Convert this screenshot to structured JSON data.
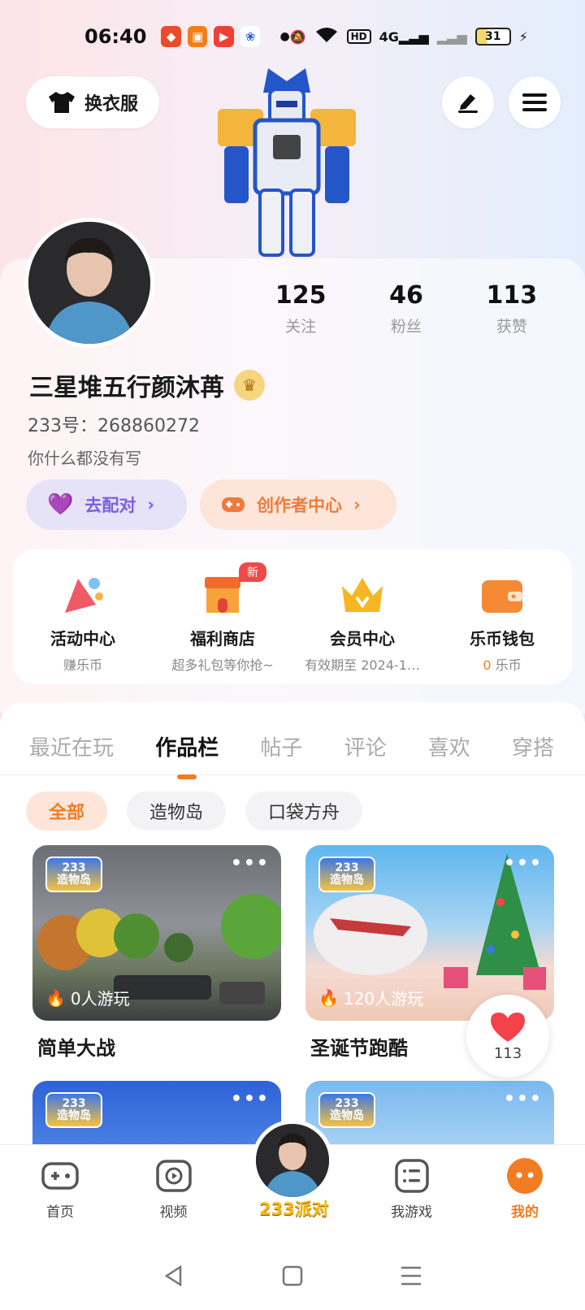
{
  "status_bar": {
    "time": "06:40",
    "network": "4G",
    "battery": "31"
  },
  "header": {
    "change_outfit_label": "换衣服"
  },
  "profile": {
    "stats": [
      {
        "value": "125",
        "label": "关注"
      },
      {
        "value": "46",
        "label": "粉丝"
      },
      {
        "value": "113",
        "label": "获赞"
      }
    ],
    "username": "三星堆五行颜沐苒",
    "uid": "233号：268860272",
    "bio": "你什么都没有写",
    "match_label": "去配对",
    "creator_label": "创作者中心"
  },
  "services": [
    {
      "title": "活动中心",
      "sub": "赚乐币",
      "icon": "party-icon"
    },
    {
      "title": "福利商店",
      "sub": "超多礼包等你抢~",
      "icon": "shop-icon",
      "badge": "新"
    },
    {
      "title": "会员中心",
      "sub": "有效期至 2024-1…",
      "icon": "crown-icon"
    },
    {
      "title": "乐币钱包",
      "sub_value": "0",
      "sub_unit": "乐币",
      "icon": "wallet-icon"
    }
  ],
  "tabs": [
    "最近在玩",
    "作品栏",
    "帖子",
    "评论",
    "喜欢",
    "穿搭"
  ],
  "active_tab": "作品栏",
  "filters": [
    "全部",
    "造物岛",
    "口袋方舟"
  ],
  "works": [
    {
      "title": "简单大战",
      "plays": "0人游玩",
      "logo_top": "233",
      "logo_bottom": "造物岛"
    },
    {
      "title": "圣诞节跑酷",
      "plays": "120人游玩",
      "logo_top": "233",
      "logo_bottom": "造物岛"
    },
    {
      "title": "",
      "plays": "",
      "logo_top": "233",
      "logo_bottom": "造物岛"
    },
    {
      "title": "",
      "plays": "",
      "logo_top": "233",
      "logo_bottom": "造物岛"
    }
  ],
  "like_float": {
    "count": "113"
  },
  "bottom_nav": {
    "home": "首页",
    "video": "视频",
    "center": "233派对",
    "my_games": "我游戏",
    "mine": "我的"
  },
  "colors": {
    "accent": "#f27c22",
    "purple": "#7a5fe0"
  }
}
